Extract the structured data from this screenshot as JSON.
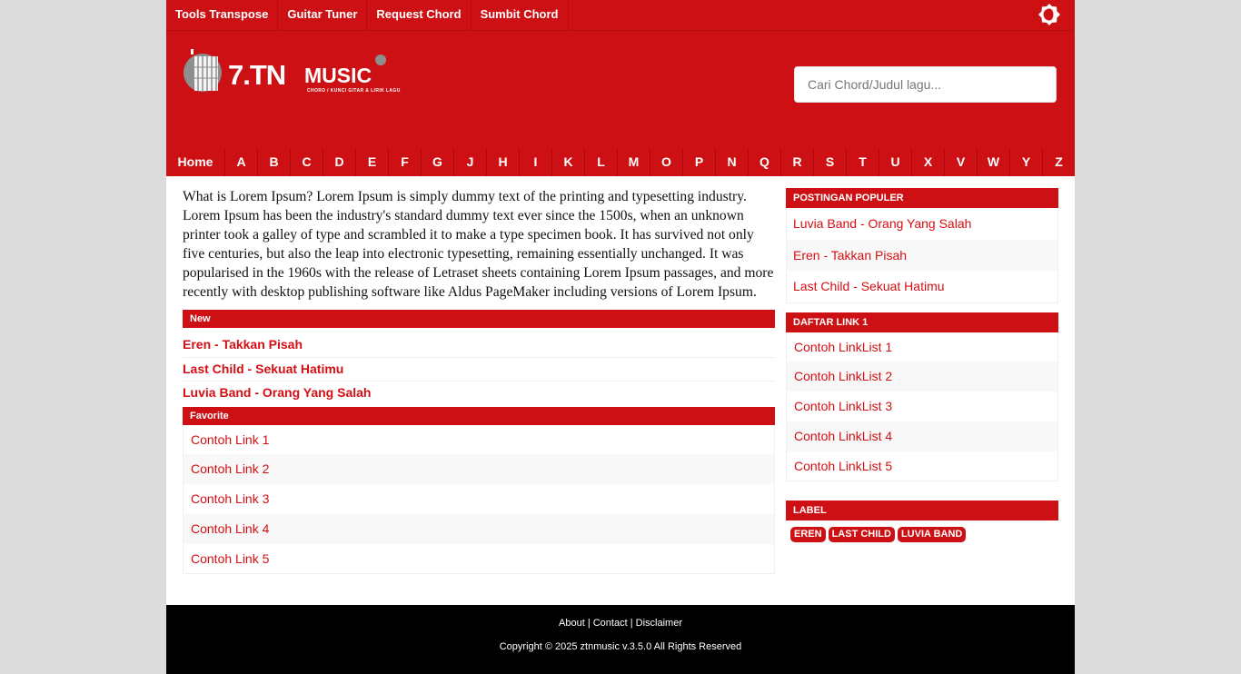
{
  "topnav": {
    "items": [
      "Tools Transpose",
      "Guitar Tuner",
      "Request Chord",
      "Sumbit Chord"
    ]
  },
  "logo": {
    "brand": "7.TN",
    "brand2": "MUSIC",
    "tagline": "CHORD / KUNCI GITAR & LIRIK LAGU"
  },
  "search": {
    "placeholder": "Cari Chord/Judul lagu..."
  },
  "alphabet": {
    "home": "Home",
    "letters": [
      "A",
      "B",
      "C",
      "D",
      "E",
      "F",
      "G",
      "J",
      "H",
      "I",
      "K",
      "L",
      "M",
      "O",
      "P",
      "N",
      "Q",
      "R",
      "S",
      "T",
      "U",
      "X",
      "V",
      "W",
      "Y",
      "Z"
    ]
  },
  "main": {
    "intro": "What is Lorem Ipsum? Lorem Ipsum is simply dummy text of the printing and typesetting industry. Lorem Ipsum has been the industry's standard dummy text ever since the 1500s, when an unknown printer took a galley of type and scrambled it to make a type specimen book. It has survived not only five centuries, but also the leap into electronic typesetting, remaining essentially unchanged. It was popularised in the 1960s with the release of Letraset sheets containing Lorem Ipsum passages, and more recently with desktop publishing software like Aldus PageMaker including versions of Lorem Ipsum.",
    "new_title": "New",
    "new_items": [
      "Eren - Takkan Pisah",
      "Last Child - Sekuat Hatimu",
      "Luvia Band - Orang Yang Salah"
    ],
    "favorite_title": "Favorite",
    "favorite_items": [
      "Contoh Link 1",
      "Contoh Link 2",
      "Contoh Link 3",
      "Contoh Link 4",
      "Contoh Link 5"
    ]
  },
  "sidebar": {
    "popular_title": "POSTINGAN POPULER",
    "popular_items": [
      "Luvia Band - Orang Yang Salah",
      "Eren - Takkan Pisah",
      "Last Child - Sekuat Hatimu"
    ],
    "linklist_title": "DAFTAR LINK 1",
    "linklist_items": [
      "Contoh LinkList 1",
      "Contoh LinkList 2",
      "Contoh LinkList 3",
      "Contoh LinkList 4",
      "Contoh LinkList 5"
    ],
    "label_title": "LABEL",
    "labels": [
      "EREN",
      "LAST CHILD",
      "LUVIA BAND"
    ]
  },
  "footer": {
    "about": "About",
    "contact": "Contact",
    "disclaimer": "Disclaimer",
    "separator": "|",
    "copyright": "Copyright © 2025 ztnmusic v.3.5.0 All Rights Reserved"
  },
  "colors": {
    "brand_red": "#cc1014",
    "link_red": "#d40f14",
    "footer_bg": "#000000"
  }
}
